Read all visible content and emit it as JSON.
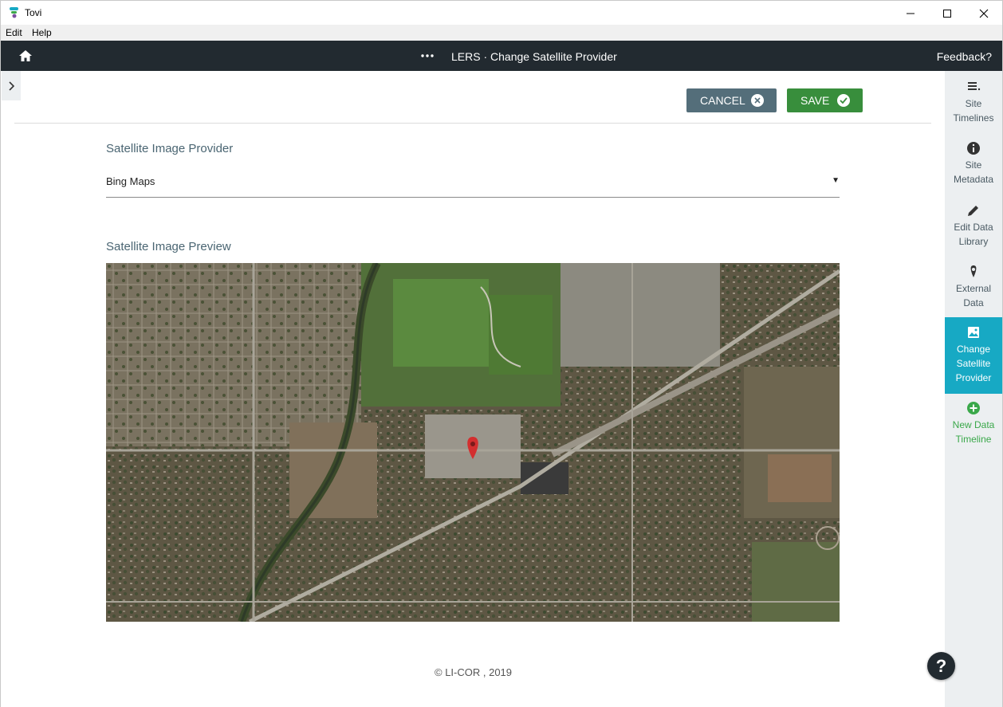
{
  "window": {
    "title": "Tovi",
    "controls": {
      "minimize": "minimize-icon",
      "maximize": "maximize-icon",
      "close": "close-icon"
    }
  },
  "menu": {
    "items": [
      "Edit",
      "Help"
    ]
  },
  "header": {
    "title": "LERS · Change Satellite Provider",
    "feedback": "Feedback?",
    "home_icon": "home-icon",
    "more_icon": "more-horizontal-icon"
  },
  "actions": {
    "cancel_label": "CANCEL",
    "save_label": "SAVE",
    "colors": {
      "cancel": "#546e7a",
      "save": "#388e3c"
    }
  },
  "form": {
    "provider_label": "Satellite Image Provider",
    "provider_value": "Bing Maps",
    "preview_label": "Satellite Image Preview"
  },
  "footer": {
    "copyright": "© LI-COR , 2019"
  },
  "sidebar": {
    "items": [
      {
        "label_1": "Site",
        "label_2": "Timelines",
        "icon": "list-icon"
      },
      {
        "label_1": "Site",
        "label_2": "Metadata",
        "icon": "info-icon"
      },
      {
        "label_1": "Edit Data",
        "label_2": "Library",
        "icon": "pencil-icon"
      },
      {
        "label_1": "External",
        "label_2": "Data",
        "icon": "map-pin-icon"
      },
      {
        "label_1": "Change",
        "label_2": "Satellite",
        "label_3": "Provider",
        "icon": "image-icon",
        "active": true
      },
      {
        "label_1": "New Data",
        "label_2": "Timeline",
        "icon": "add-circle-icon"
      }
    ],
    "active_color": "#17a9c4",
    "add_color": "#3aa84a"
  },
  "help": {
    "label": "?"
  }
}
